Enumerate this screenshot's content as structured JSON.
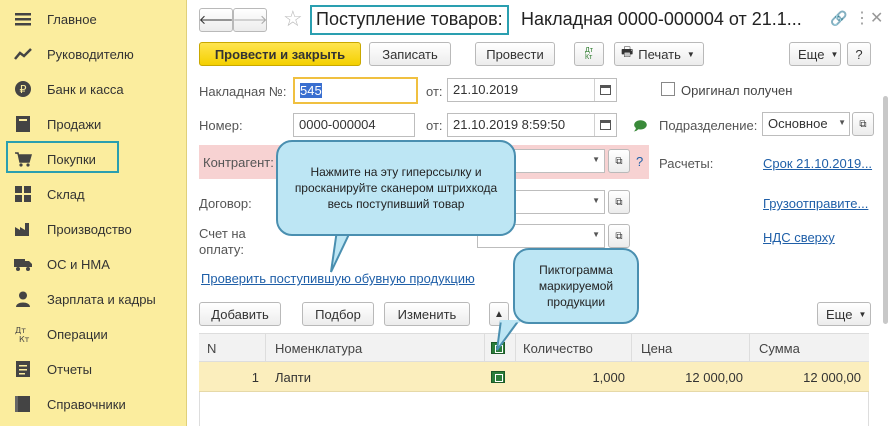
{
  "sidebar": {
    "items": [
      {
        "label": "Главное",
        "icon": "menu-icon"
      },
      {
        "label": "Руководителю",
        "icon": "trend-icon"
      },
      {
        "label": "Банк и касса",
        "icon": "coin-icon"
      },
      {
        "label": "Продажи",
        "icon": "ledger-icon"
      },
      {
        "label": "Покупки",
        "icon": "cart-icon"
      },
      {
        "label": "Склад",
        "icon": "warehouse-icon"
      },
      {
        "label": "Производство",
        "icon": "factory-icon"
      },
      {
        "label": "ОС и НМА",
        "icon": "truck-icon"
      },
      {
        "label": "Зарплата и кадры",
        "icon": "person-icon"
      },
      {
        "label": "Операции",
        "icon": "dt-kt-icon"
      },
      {
        "label": "Отчеты",
        "icon": "report-icon"
      },
      {
        "label": "Справочники",
        "icon": "book-icon"
      }
    ]
  },
  "header": {
    "title_highlight": "Поступление товаров:",
    "title_rest": "Накладная 0000-000004 от 21.1..."
  },
  "toolbar": {
    "post_close": "Провести и закрыть",
    "save": "Записать",
    "post": "Провести",
    "dtkt": "Дт\nКт",
    "print": "Печать",
    "more": "Еще",
    "help": "?"
  },
  "form": {
    "invoice_label": "Накладная №:",
    "invoice_value": "545",
    "from_label": "от:",
    "invoice_date": "21.10.2019",
    "original_label": "Оригинал получен",
    "number_label": "Номер:",
    "number_value": "0000-000004",
    "number_date": "21.10.2019  8:59:50",
    "division_label": "Подразделение:",
    "division_value": "Основное",
    "counterparty_label": "Контрагент:",
    "question": "?",
    "payments_label": "Расчеты:",
    "payments_link": "Срок 21.10.2019...",
    "contract_label": "Договор:",
    "consignor_link": "Грузоотправите...",
    "invoice_pay_label_1": "Счет на",
    "invoice_pay_label_2": "оплату:",
    "vat_link": "НДС сверху",
    "check_link": "Проверить поступившую обувную продукцию"
  },
  "callouts": {
    "scan": "Нажмите на эту гиперссылку и просканируйте сканером штрихкода весь поступивший товар",
    "icon": "Пиктограмма маркируемой продукции"
  },
  "table_toolbar": {
    "add": "Добавить",
    "select": "Подбор",
    "edit": "Изменить",
    "more": "Еще"
  },
  "table": {
    "headers": [
      "N",
      "Номенклатура",
      "Количество",
      "Цена",
      "Сумма"
    ],
    "rows": [
      {
        "n": "1",
        "name": "Лапти",
        "qty": "1,000",
        "price": "12 000,00",
        "sum": "12 000,00"
      }
    ]
  }
}
